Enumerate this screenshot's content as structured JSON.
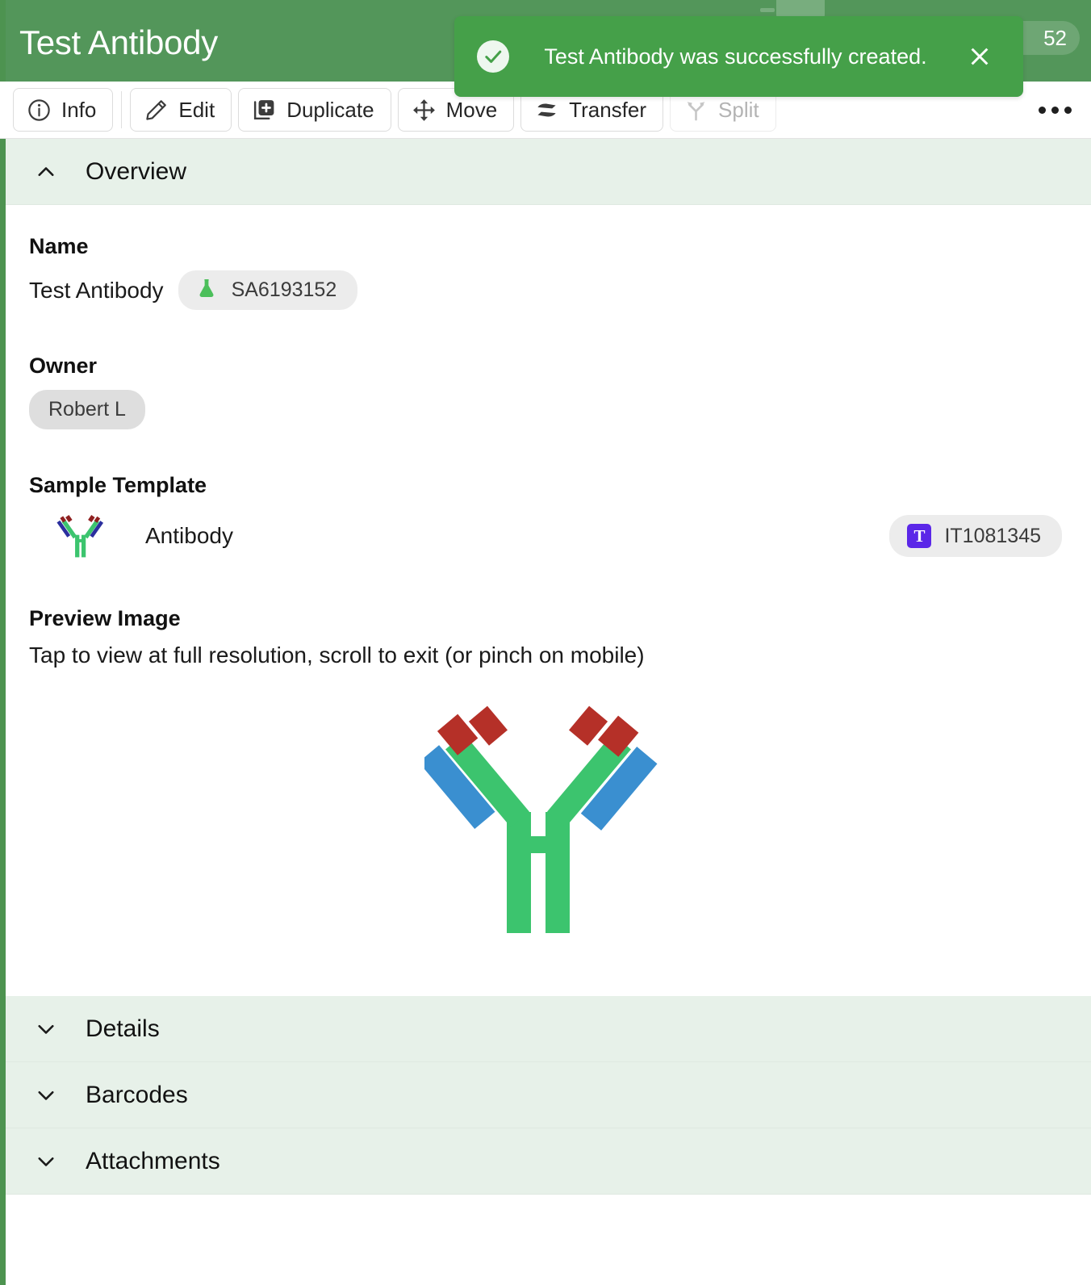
{
  "header": {
    "title": "Test Antibody",
    "badge_text": "52",
    "bg_color": "#53965a"
  },
  "toast": {
    "message": "Test Antibody was successfully created.",
    "icon": "check-circle-icon",
    "close_icon": "close-icon",
    "bg_color": "#45a049"
  },
  "toolbar": {
    "buttons": [
      {
        "label": "Info",
        "icon": "info-circle-icon",
        "disabled": false
      },
      {
        "label": "Edit",
        "icon": "pencil-icon",
        "disabled": false
      },
      {
        "label": "Duplicate",
        "icon": "duplicate-plus-icon",
        "disabled": false
      },
      {
        "label": "Move",
        "icon": "move-arrows-icon",
        "disabled": false
      },
      {
        "label": "Transfer",
        "icon": "transfer-arrows-icon",
        "disabled": false
      },
      {
        "label": "Split",
        "icon": "split-fork-icon",
        "disabled": true
      }
    ],
    "more_label": "more-options"
  },
  "overview": {
    "section_title": "Overview",
    "expanded": true,
    "name": {
      "label": "Name",
      "value": "Test Antibody",
      "badge_id": "SA6193152",
      "badge_icon": "flask-icon"
    },
    "owner": {
      "label": "Owner",
      "value": "Robert L"
    },
    "sample_template": {
      "label": "Sample Template",
      "name": "Antibody",
      "thumb_icon": "antibody-icon",
      "template_id": "IT1081345",
      "template_id_icon_letter": "T",
      "template_id_icon_color": "#5b27e8"
    },
    "preview_image": {
      "label": "Preview Image",
      "help_text": "Tap to view at full resolution, scroll to exit (or pinch on mobile)",
      "alt": "antibody-diagram",
      "colors": {
        "heavy_chain": "#3cc46e",
        "light_chain": "#3a8fd0",
        "variable_region": "#b53028"
      }
    }
  },
  "sections": [
    {
      "title": "Details",
      "expanded": false,
      "icon": "chevron-down-icon"
    },
    {
      "title": "Barcodes",
      "expanded": false,
      "icon": "chevron-down-icon"
    },
    {
      "title": "Attachments",
      "expanded": false,
      "icon": "chevron-down-icon"
    }
  ],
  "colors": {
    "section_band": "#e7f1e9",
    "accent_green": "#4d9350"
  }
}
